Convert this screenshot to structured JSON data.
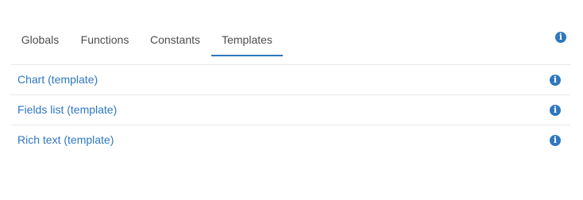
{
  "tabs": [
    {
      "label": "Globals",
      "active": false
    },
    {
      "label": "Functions",
      "active": false
    },
    {
      "label": "Constants",
      "active": false
    },
    {
      "label": "Templates",
      "active": true
    }
  ],
  "header": {
    "info_icon": "info-icon"
  },
  "templates": [
    {
      "label": "Chart (template)",
      "icon": "info-icon"
    },
    {
      "label": "Fields list (template)",
      "icon": "info-icon"
    },
    {
      "label": "Rich text (template)",
      "icon": "info-icon"
    }
  ],
  "colors": {
    "accent": "#2f77c0",
    "text": "#4c4c4c",
    "divider": "#e8e8e8"
  }
}
